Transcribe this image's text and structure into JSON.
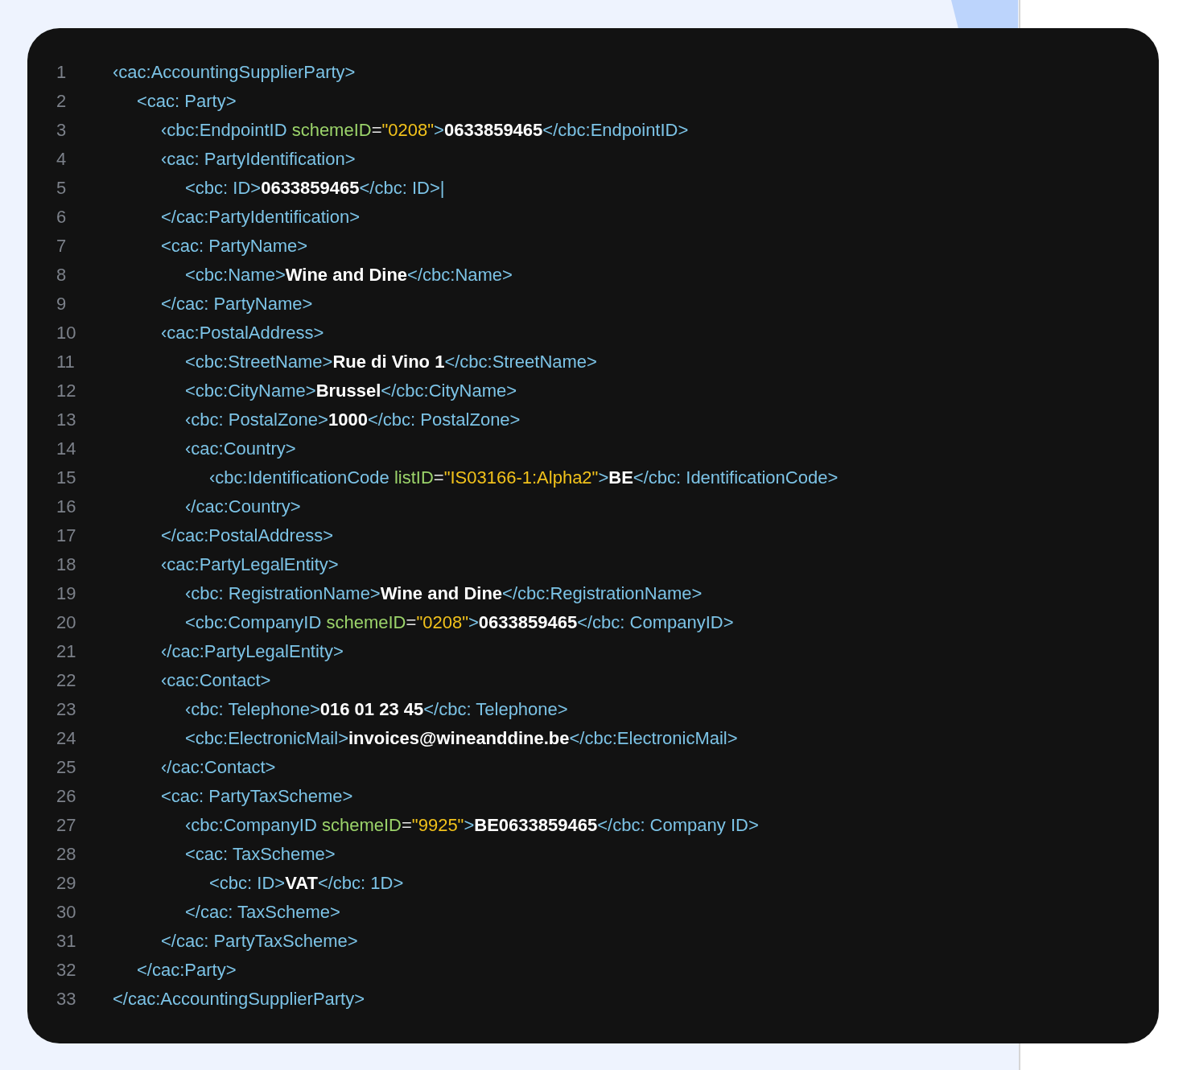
{
  "code_lines": [
    {
      "number": "1",
      "parts": [
        {
          "kind": "tag",
          "text": "‹cac:AccountingSupplierParty>"
        }
      ],
      "children": [
        {
          "number": "2",
          "parts": [
            {
              "kind": "tag",
              "text": "<cac: Party>"
            }
          ],
          "children": [
            {
              "number": "3",
              "parts": [
                {
                  "kind": "tag",
                  "text": "‹cbc:EndpointID "
                },
                {
                  "kind": "attr",
                  "text": "schemeID"
                },
                {
                  "kind": "eq",
                  "text": "="
                },
                {
                  "kind": "str",
                  "text": "\"0208\""
                },
                {
                  "kind": "tag",
                  "text": ">"
                },
                {
                  "kind": "value",
                  "text": "0633859465"
                },
                {
                  "kind": "tag",
                  "text": "</cbc:EndpointID>"
                }
              ]
            },
            {
              "number": "4",
              "parts": [
                {
                  "kind": "tag",
                  "text": "‹cac: PartyIdentification>"
                }
              ],
              "children": [
                {
                  "number": "5",
                  "parts": [
                    {
                      "kind": "tag",
                      "text": "<cbc: ID>"
                    },
                    {
                      "kind": "value",
                      "text": "0633859465"
                    },
                    {
                      "kind": "tag",
                      "text": "</cbc: ID>|"
                    }
                  ]
                }
              ]
            },
            {
              "number": "6",
              "parts": [
                {
                  "kind": "tag",
                  "text": "</cac:PartyIdentification>"
                }
              ]
            },
            {
              "number": "7",
              "parts": [
                {
                  "kind": "tag",
                  "text": "<cac: PartyName>"
                }
              ],
              "children": [
                {
                  "number": "8",
                  "parts": [
                    {
                      "kind": "tag",
                      "text": "<cbc:Name>"
                    },
                    {
                      "kind": "value",
                      "text": "Wine and Dine"
                    },
                    {
                      "kind": "tag",
                      "text": "</cbc:Name>"
                    }
                  ]
                }
              ]
            },
            {
              "number": "9",
              "parts": [
                {
                  "kind": "tag",
                  "text": "</cac: PartyName>"
                }
              ]
            },
            {
              "number": "10",
              "parts": [
                {
                  "kind": "tag",
                  "text": "‹cac:PostalAddress>"
                }
              ],
              "children": [
                {
                  "number": "11",
                  "parts": [
                    {
                      "kind": "tag",
                      "text": "<cbc:StreetName>"
                    },
                    {
                      "kind": "value",
                      "text": "Rue di Vino 1"
                    },
                    {
                      "kind": "tag",
                      "text": "</cbc:StreetName>"
                    }
                  ]
                },
                {
                  "number": "12",
                  "parts": [
                    {
                      "kind": "tag",
                      "text": "<cbc:CityName>"
                    },
                    {
                      "kind": "value",
                      "text": "Brussel"
                    },
                    {
                      "kind": "tag",
                      "text": "</cbc:CityName>"
                    }
                  ]
                },
                {
                  "number": "13",
                  "parts": [
                    {
                      "kind": "tag",
                      "text": "‹cbc: PostalZone>"
                    },
                    {
                      "kind": "value",
                      "text": "1000"
                    },
                    {
                      "kind": "tag",
                      "text": "</cbc: PostalZone>"
                    }
                  ]
                },
                {
                  "number": "14",
                  "parts": [
                    {
                      "kind": "tag",
                      "text": "‹cac:Country>"
                    }
                  ],
                  "children": [
                    {
                      "number": "15",
                      "parts": [
                        {
                          "kind": "tag",
                          "text": "‹cbc:IdentificationCode "
                        },
                        {
                          "kind": "attr",
                          "text": "listID"
                        },
                        {
                          "kind": "eq",
                          "text": "="
                        },
                        {
                          "kind": "str",
                          "text": "\"IS03166-1:Alpha2\""
                        },
                        {
                          "kind": "tag",
                          "text": ">"
                        },
                        {
                          "kind": "value",
                          "text": "BE"
                        },
                        {
                          "kind": "tag",
                          "text": "</cbc: IdentificationCode>"
                        }
                      ]
                    }
                  ]
                },
                {
                  "number": "16",
                  "parts": [
                    {
                      "kind": "tag",
                      "text": "‹/cac:Country>"
                    }
                  ]
                }
              ]
            },
            {
              "number": "17",
              "parts": [
                {
                  "kind": "tag",
                  "text": "</cac:PostalAddress>"
                }
              ]
            },
            {
              "number": "18",
              "parts": [
                {
                  "kind": "tag",
                  "text": "‹cac:PartyLegalEntity>"
                }
              ],
              "children": [
                {
                  "number": "19",
                  "parts": [
                    {
                      "kind": "tag",
                      "text": "‹cbc: RegistrationName>"
                    },
                    {
                      "kind": "value",
                      "text": "Wine and Dine"
                    },
                    {
                      "kind": "tag",
                      "text": "</cbc:RegistrationName>"
                    }
                  ]
                },
                {
                  "number": "20",
                  "parts": [
                    {
                      "kind": "tag",
                      "text": "<cbc:CompanyID "
                    },
                    {
                      "kind": "attr",
                      "text": "schemeID"
                    },
                    {
                      "kind": "eq",
                      "text": "="
                    },
                    {
                      "kind": "str",
                      "text": "\"0208\""
                    },
                    {
                      "kind": "tag",
                      "text": ">"
                    },
                    {
                      "kind": "value",
                      "text": "0633859465"
                    },
                    {
                      "kind": "tag",
                      "text": "</cbc: CompanyID>"
                    }
                  ]
                }
              ]
            },
            {
              "number": "21",
              "parts": [
                {
                  "kind": "tag",
                  "text": "‹/cac:PartyLegalEntity>"
                }
              ]
            },
            {
              "number": "22",
              "parts": [
                {
                  "kind": "tag",
                  "text": "‹cac:Contact>"
                }
              ],
              "children": [
                {
                  "number": "23",
                  "parts": [
                    {
                      "kind": "tag",
                      "text": "‹cbc: Telephone>"
                    },
                    {
                      "kind": "value",
                      "text": "016 01 23 45"
                    },
                    {
                      "kind": "tag",
                      "text": "</cbc: Telephone>"
                    }
                  ]
                },
                {
                  "number": "24",
                  "parts": [
                    {
                      "kind": "tag",
                      "text": "<cbc:ElectronicMail>"
                    },
                    {
                      "kind": "value",
                      "text": "invoices@wineanddine.be"
                    },
                    {
                      "kind": "tag",
                      "text": "</cbc:ElectronicMail>"
                    }
                  ]
                }
              ]
            },
            {
              "number": "25",
              "parts": [
                {
                  "kind": "tag",
                  "text": "‹/cac:Contact>"
                }
              ]
            },
            {
              "number": "26",
              "parts": [
                {
                  "kind": "tag",
                  "text": "<cac: PartyTaxScheme>"
                }
              ],
              "children": [
                {
                  "number": "27",
                  "parts": [
                    {
                      "kind": "tag",
                      "text": "‹cbc:CompanyID "
                    },
                    {
                      "kind": "attr",
                      "text": "schemeID"
                    },
                    {
                      "kind": "eq",
                      "text": "="
                    },
                    {
                      "kind": "str",
                      "text": "\"9925\""
                    },
                    {
                      "kind": "tag",
                      "text": ">"
                    },
                    {
                      "kind": "value",
                      "text": "BE0633859465"
                    },
                    {
                      "kind": "tag",
                      "text": "</cbc: Company ID>"
                    }
                  ]
                },
                {
                  "number": "28",
                  "parts": [
                    {
                      "kind": "tag",
                      "text": "<cac: TaxScheme>"
                    }
                  ],
                  "children": [
                    {
                      "number": "29",
                      "parts": [
                        {
                          "kind": "tag",
                          "text": "<cbc: ID>"
                        },
                        {
                          "kind": "value",
                          "text": "VAT"
                        },
                        {
                          "kind": "tag",
                          "text": "</cbc: 1D>"
                        }
                      ]
                    }
                  ]
                },
                {
                  "number": "30",
                  "parts": [
                    {
                      "kind": "tag",
                      "text": "</cac: TaxScheme>"
                    }
                  ]
                }
              ]
            },
            {
              "number": "31",
              "parts": [
                {
                  "kind": "tag",
                  "text": "</cac: PartyTaxScheme>"
                }
              ]
            }
          ]
        },
        {
          "number": "32",
          "parts": [
            {
              "kind": "tag",
              "text": "</cac:Party>"
            }
          ]
        }
      ]
    },
    {
      "number": "33",
      "parts": [
        {
          "kind": "tag",
          "text": "</cac:AccountingSupplierParty>"
        }
      ]
    }
  ]
}
